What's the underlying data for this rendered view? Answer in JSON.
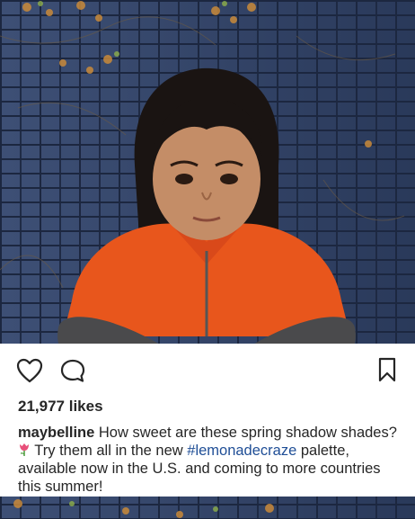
{
  "post": {
    "likes": "21,977 likes",
    "username": "maybelline",
    "caption_part1": "How sweet are these spring shadow shades?",
    "caption_part2": "Try them all in the new",
    "hashtag": "#lemonadecraze",
    "caption_part3": "palette, available now in the U.S. and coming to more countries this summer!"
  },
  "icons": {
    "like": "heart-icon",
    "comment": "comment-icon",
    "save": "bookmark-icon",
    "emoji": "tulip-emoji"
  },
  "colors": {
    "hashtag": "#1f4e96",
    "jacket": "#e8561c",
    "wall": "#33466e"
  }
}
